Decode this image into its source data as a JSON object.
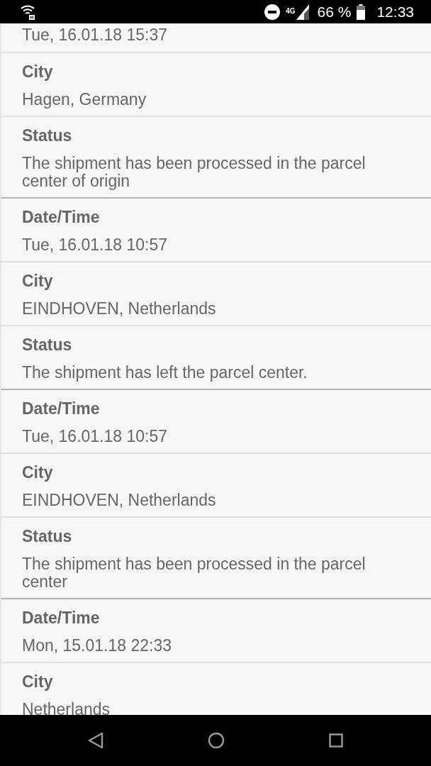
{
  "status_bar": {
    "network": "4G",
    "battery": "66 %",
    "time": "12:33"
  },
  "entries": [
    {
      "fields": [
        {
          "value": "Tue, 16.01.18 15:37"
        },
        {
          "label": "City",
          "value": "Hagen, Germany"
        },
        {
          "label": "Status",
          "value": "The shipment has been processed in the parcel center of origin"
        }
      ]
    },
    {
      "fields": [
        {
          "label": "Date/Time",
          "value": "Tue, 16.01.18 10:57"
        },
        {
          "label": "City",
          "value": "EINDHOVEN, Netherlands"
        },
        {
          "label": "Status",
          "value": "The shipment has left the parcel center."
        }
      ]
    },
    {
      "fields": [
        {
          "label": "Date/Time",
          "value": "Tue, 16.01.18 10:57"
        },
        {
          "label": "City",
          "value": "EINDHOVEN, Netherlands"
        },
        {
          "label": "Status",
          "value": "The shipment has been processed in the parcel center"
        }
      ]
    },
    {
      "fields": [
        {
          "label": "Date/Time",
          "value": "Mon, 15.01.18 22:33"
        },
        {
          "label": "City",
          "value": "Netherlands"
        }
      ]
    }
  ]
}
